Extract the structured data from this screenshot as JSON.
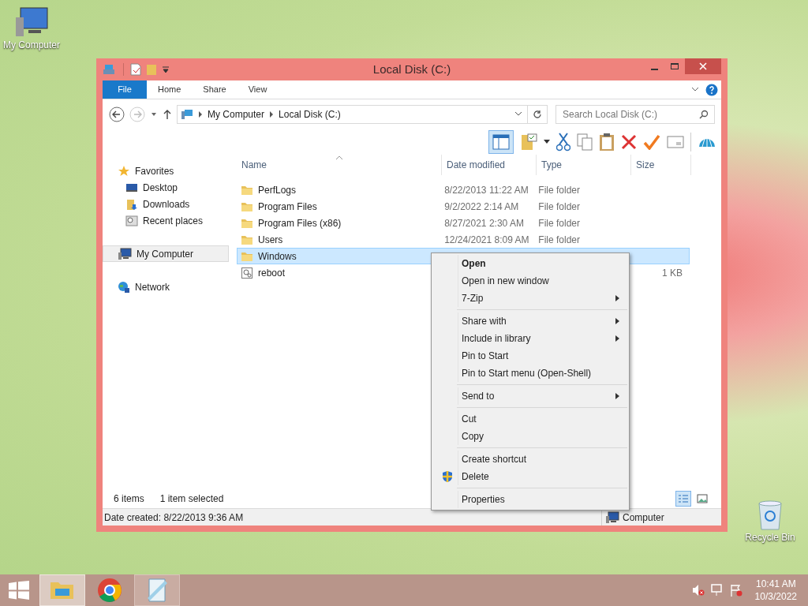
{
  "desktop_icons": [
    {
      "label": "My Computer",
      "kind": "computer"
    },
    {
      "label": "Recycle Bin",
      "kind": "bin"
    }
  ],
  "window": {
    "title": "Local Disk (C:)"
  },
  "ribbon_tabs": [
    {
      "label": "File",
      "kind": "file"
    },
    {
      "label": "Home",
      "kind": "tab"
    },
    {
      "label": "Share",
      "kind": "tab"
    },
    {
      "label": "View",
      "kind": "tab"
    }
  ],
  "address": {
    "breadcrumbs": [
      "My Computer",
      "Local Disk (C:)"
    ]
  },
  "search": {
    "placeholder": "Search Local Disk (C:)"
  },
  "navigation": [
    {
      "label": "Favorites",
      "kind": "star",
      "selected": false,
      "children": [
        {
          "label": "Desktop",
          "kind": "desktop",
          "selected": false
        },
        {
          "label": "Downloads",
          "kind": "downloads",
          "selected": false
        },
        {
          "label": "Recent places",
          "kind": "recent",
          "selected": false
        }
      ]
    },
    {
      "label": "My Computer",
      "kind": "computer",
      "selected": true
    },
    {
      "label": "Network",
      "kind": "network",
      "selected": false
    }
  ],
  "columns": [
    "Name",
    "Date modified",
    "Type",
    "Size"
  ],
  "files": [
    {
      "name": "PerfLogs",
      "date": "8/22/2013 11:22 AM",
      "type": "File folder",
      "kind": "folder",
      "selected": false
    },
    {
      "name": "Program Files",
      "date": "9/2/2022 2:14 AM",
      "type": "File folder",
      "kind": "folder",
      "selected": false
    },
    {
      "name": "Program Files (x86)",
      "date": "8/27/2021 2:30 AM",
      "type": "File folder",
      "kind": "folder",
      "selected": false
    },
    {
      "name": "Users",
      "date": "12/24/2021 8:09 AM",
      "type": "File folder",
      "kind": "folder",
      "selected": false
    },
    {
      "name": "Windows",
      "kind": "folder",
      "selected": true
    },
    {
      "name": "reboot",
      "size": "1 KB",
      "kind": "script",
      "selected": false
    }
  ],
  "status": {
    "item_count": "6 items",
    "selection": "1 item selected",
    "date_created": "Date created: 8/22/2013 9:36 AM",
    "location": "Computer"
  },
  "context_menu": {
    "groups": [
      [
        {
          "label": "Open",
          "default": true,
          "submenu": false,
          "kind": "plain"
        },
        {
          "label": "Open in new window",
          "default": false,
          "submenu": false,
          "kind": "plain"
        },
        {
          "label": "7-Zip",
          "default": false,
          "submenu": true,
          "kind": "plain"
        }
      ],
      [
        {
          "label": "Share with",
          "default": false,
          "submenu": true,
          "kind": "plain"
        },
        {
          "label": "Include in library",
          "default": false,
          "submenu": true,
          "kind": "plain"
        },
        {
          "label": "Pin to Start",
          "default": false,
          "submenu": false,
          "kind": "plain"
        },
        {
          "label": "Pin to Start menu (Open-Shell)",
          "default": false,
          "submenu": false,
          "kind": "plain"
        }
      ],
      [
        {
          "label": "Send to",
          "default": false,
          "submenu": true,
          "kind": "plain"
        }
      ],
      [
        {
          "label": "Cut",
          "default": false,
          "submenu": false,
          "kind": "plain"
        },
        {
          "label": "Copy",
          "default": false,
          "submenu": false,
          "kind": "plain"
        }
      ],
      [
        {
          "label": "Create shortcut",
          "default": false,
          "submenu": false,
          "kind": "plain"
        },
        {
          "label": "Delete",
          "default": false,
          "submenu": false,
          "kind": "shield"
        }
      ],
      [
        {
          "label": "Properties",
          "default": false,
          "submenu": false,
          "kind": "plain"
        }
      ]
    ]
  },
  "taskbar": {
    "apps": [
      {
        "kind": "explorer",
        "selected": true
      },
      {
        "kind": "chrome",
        "selected": false
      },
      {
        "kind": "notepad",
        "selected": false
      }
    ],
    "time": "10:41 AM",
    "date": "10/3/2022"
  }
}
